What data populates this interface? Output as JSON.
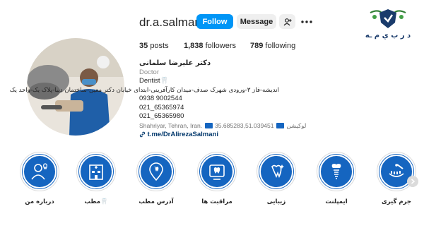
{
  "logo": {
    "text": "د ر  ب ي م ـه"
  },
  "profile": {
    "username": "dr.a.salmani",
    "follow_label": "Follow",
    "message_label": "Message",
    "suggest_icon": "person-add-icon",
    "more_icon": "more-horizontal-icon",
    "stats": {
      "posts_count": "35",
      "posts_label": "posts",
      "followers_count": "1,838",
      "followers_label": "followers",
      "following_count": "789",
      "following_label": "following"
    }
  },
  "bio": {
    "full_name": "دکتر علیرضا سلمانی",
    "category": "Doctor",
    "line_dentist": "Dentist🦷",
    "line_address": "اندیشه-فاز ۳-ورودی شهرک صدف-میدان کارآفرینی-ابتدای خیابان دکتر معین-ساختمان دیبا-پلاک یک-واحد یک",
    "phone_1": "0938 9002544",
    "phone_2": "021_65365974",
    "phone_3": "021_65365980",
    "location_text": "Shahriyar, Tehran, Iran.",
    "location_label": "لوکیشن",
    "coordinates": "35.685283,51.039451",
    "link": "t.me/DrAlirezaSalmani"
  },
  "highlights": [
    {
      "label": "درباره من",
      "icon": "person-tooth-icon"
    },
    {
      "label": "مطب🦷",
      "icon": "clinic-building-icon"
    },
    {
      "label": "آدرس مطب",
      "icon": "location-pin-icon"
    },
    {
      "label": "مراقبت ها",
      "icon": "tooth-care-icon"
    },
    {
      "label": "زیبایی",
      "icon": "sparkle-tooth-icon"
    },
    {
      "label": "ایمپلنت",
      "icon": "implant-icon"
    },
    {
      "label": "جرم گیری",
      "icon": "scaling-icon"
    }
  ],
  "colors": {
    "accent": "#0095f6",
    "highlight_fill": "#1565c0",
    "link": "#00376b"
  }
}
